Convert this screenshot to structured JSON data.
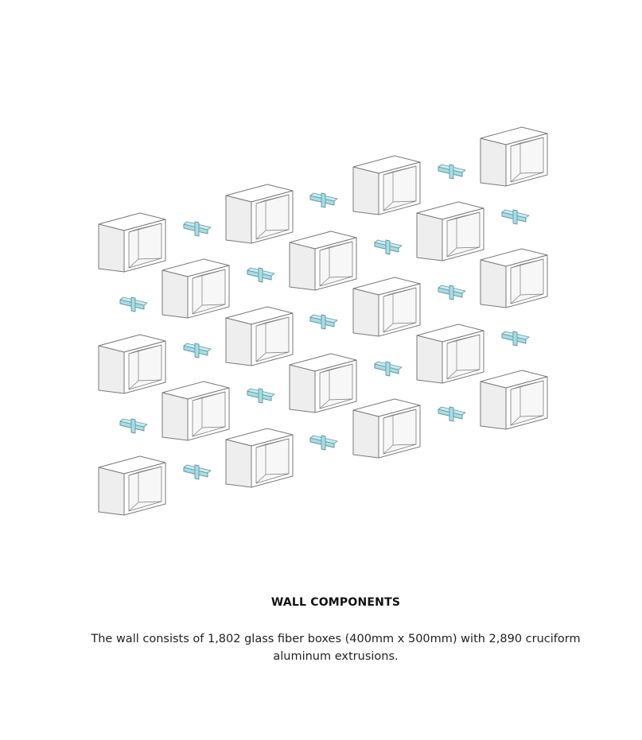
{
  "title": "WALL COMPONENTS",
  "caption": "The wall consists of 1,802 glass fiber boxes (400mm x 500mm) with 2,890 cruciform aluminum extrusions.",
  "colors": {
    "box_stroke": "#7a7a7a",
    "box_face": "#ffffff",
    "box_side": "#eeeeee",
    "box_inner": "#f7f7f7",
    "extrusion_fill": "#a9dce3",
    "extrusion_stroke": "#5f9aa6"
  }
}
